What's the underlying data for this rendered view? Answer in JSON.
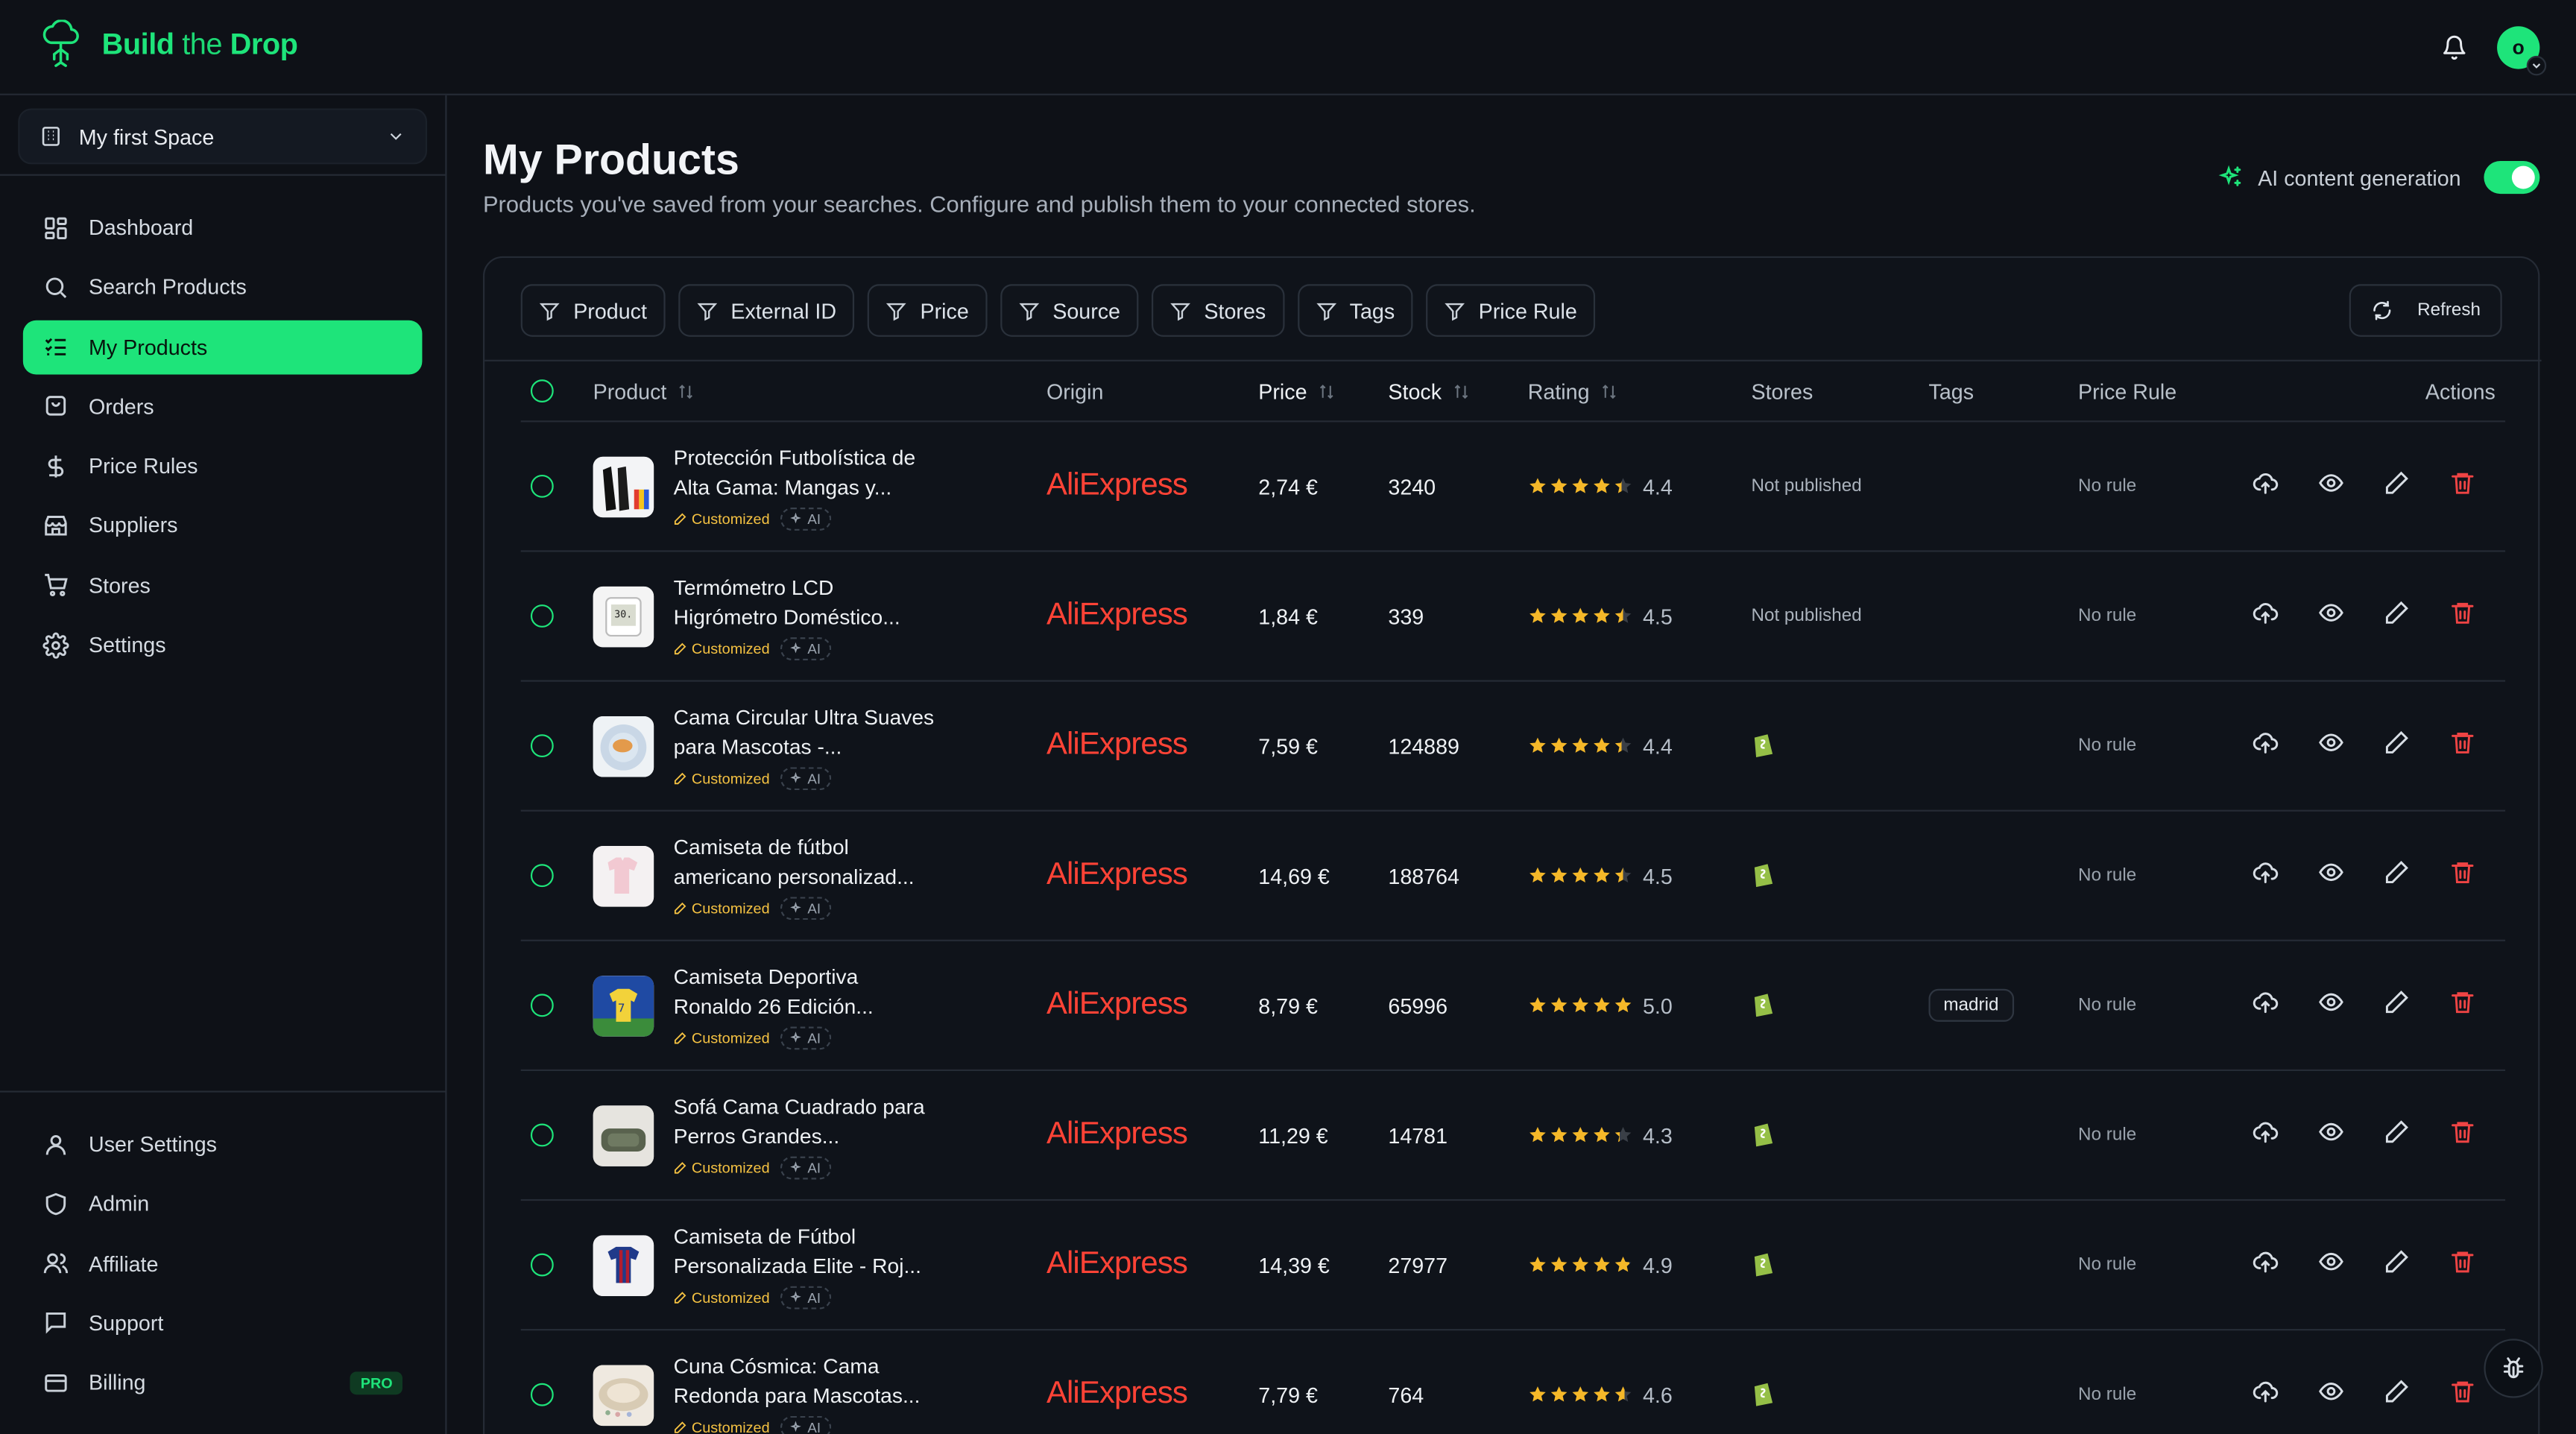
{
  "brand": {
    "prefix": "Build",
    "middle": " the ",
    "suffix": "Drop"
  },
  "header": {
    "avatar_letter": "o"
  },
  "sidebar": {
    "space": "My first Space",
    "items": [
      {
        "label": "Dashboard",
        "icon": "dashboard-icon"
      },
      {
        "label": "Search Products",
        "icon": "search-icon"
      },
      {
        "label": "My Products",
        "icon": "list-check-icon",
        "active": true
      },
      {
        "label": "Orders",
        "icon": "package-icon"
      },
      {
        "label": "Price Rules",
        "icon": "dollar-icon"
      },
      {
        "label": "Suppliers",
        "icon": "store-icon"
      },
      {
        "label": "Stores",
        "icon": "cart-icon"
      },
      {
        "label": "Settings",
        "icon": "gear-icon"
      }
    ],
    "bottom": [
      {
        "label": "User Settings",
        "icon": "user-icon"
      },
      {
        "label": "Admin",
        "icon": "shield-icon"
      },
      {
        "label": "Affiliate",
        "icon": "users-icon"
      },
      {
        "label": "Support",
        "icon": "message-icon"
      },
      {
        "label": "Billing",
        "icon": "card-icon",
        "badge": "PRO"
      }
    ]
  },
  "page": {
    "title": "My Products",
    "subtitle": "Products you've saved from your searches. Configure and publish them to your connected stores.",
    "ai_label": "AI content generation",
    "ai_enabled": true
  },
  "filters": [
    "Product",
    "External ID",
    "Price",
    "Source",
    "Stores",
    "Tags",
    "Price Rule"
  ],
  "refresh_label": "Refresh",
  "columns": {
    "product": "Product",
    "origin": "Origin",
    "price": "Price",
    "stock": "Stock",
    "rating": "Rating",
    "stores": "Stores",
    "tags": "Tags",
    "price_rule": "Price Rule",
    "actions": "Actions"
  },
  "badges": {
    "customized": "Customized",
    "ai": "AI"
  },
  "rows": [
    {
      "title": "Protección Futbolística de Alta Gama: Mangas y...",
      "origin": "AliExpress",
      "price": "2,74 €",
      "stock": "3240",
      "rating": "4.4",
      "stars": 4.4,
      "stores": "Not published",
      "tag": "",
      "rule": "No rule",
      "thumb": "sleeves"
    },
    {
      "title": "Termómetro LCD Higrómetro Doméstico...",
      "origin": "AliExpress",
      "price": "1,84 €",
      "stock": "339",
      "rating": "4.5",
      "stars": 4.5,
      "stores": "Not published",
      "tag": "",
      "rule": "No rule",
      "thumb": "thermo"
    },
    {
      "title": "Cama Circular Ultra Suaves para Mascotas -...",
      "origin": "AliExpress",
      "price": "7,59 €",
      "stock": "124889",
      "rating": "4.4",
      "stars": 4.4,
      "stores": "shopify",
      "tag": "",
      "rule": "No rule",
      "thumb": "bed"
    },
    {
      "title": "Camiseta de fútbol americano personalizad...",
      "origin": "AliExpress",
      "price": "14,69 €",
      "stock": "188764",
      "rating": "4.5",
      "stars": 4.5,
      "stores": "shopify",
      "tag": "",
      "rule": "No rule",
      "thumb": "jersey-pink"
    },
    {
      "title": "Camiseta Deportiva Ronaldo 26 Edición...",
      "origin": "AliExpress",
      "price": "8,79 €",
      "stock": "65996",
      "rating": "5.0",
      "stars": 5.0,
      "stores": "shopify",
      "tag": "madrid",
      "rule": "No rule",
      "thumb": "jersey-blue"
    },
    {
      "title": "Sofá Cama Cuadrado para Perros Grandes...",
      "origin": "AliExpress",
      "price": "11,29 €",
      "stock": "14781",
      "rating": "4.3",
      "stars": 4.3,
      "stores": "shopify",
      "tag": "",
      "rule": "No rule",
      "thumb": "sofa"
    },
    {
      "title": "Camiseta de Fútbol Personalizada Elite - Roj...",
      "origin": "AliExpress",
      "price": "14,39 €",
      "stock": "27977",
      "rating": "4.9",
      "stars": 4.9,
      "stores": "shopify",
      "tag": "",
      "rule": "No rule",
      "thumb": "jersey-red"
    },
    {
      "title": "Cuna Cósmica: Cama Redonda para Mascotas...",
      "origin": "AliExpress",
      "price": "7,79 €",
      "stock": "764",
      "rating": "4.6",
      "stars": 4.6,
      "stores": "shopify",
      "tag": "",
      "rule": "No rule",
      "thumb": "round-bed"
    }
  ],
  "colors": {
    "accent": "#1ee47a",
    "danger": "#ef4444",
    "aliexpress": "#ff4336",
    "background": "#0e1117"
  }
}
